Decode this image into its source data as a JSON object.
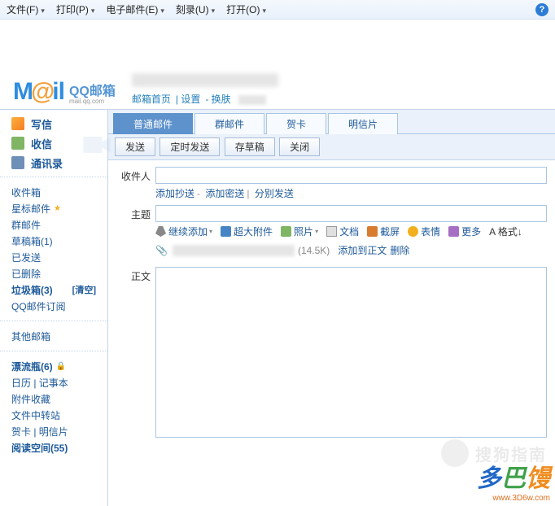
{
  "topbar": {
    "items": [
      "文件(F)",
      "打印(P)",
      "电子邮件(E)",
      "刻录(U)",
      "打开(O)"
    ],
    "help": "?"
  },
  "logo": {
    "brand_html": "M@il",
    "product": "QQ邮箱",
    "domain": "mail.qq.com"
  },
  "header_links": {
    "home": "邮箱首页",
    "settings": "设置",
    "switch": "换肤"
  },
  "sidebar": {
    "compose": "写信",
    "receive": "收信",
    "contacts": "通讯录",
    "folders": [
      {
        "label": "收件箱"
      },
      {
        "label": "星标邮件",
        "star": true
      },
      {
        "label": "群邮件"
      },
      {
        "label": "草稿箱(1)"
      },
      {
        "label": "已发送"
      },
      {
        "label": "已删除"
      },
      {
        "label": "垃圾箱(3)",
        "bold": true,
        "aux": "[清空]"
      },
      {
        "label": "QQ邮件订阅"
      }
    ],
    "other_header": "其他邮箱",
    "others": [
      {
        "label": "漂流瓶(6)",
        "bold": true,
        "lock": true
      },
      {
        "label": "日历 | 记事本"
      },
      {
        "label": "附件收藏"
      },
      {
        "label": "文件中转站"
      },
      {
        "label": "贺卡 | 明信片"
      },
      {
        "label": "阅读空间(55)",
        "bold": true
      }
    ]
  },
  "tabs": [
    "普通邮件",
    "群邮件",
    "贺卡",
    "明信片"
  ],
  "actions": [
    "发送",
    "定时发送",
    "存草稿",
    "关闭"
  ],
  "form": {
    "to_label": "收件人",
    "cc": {
      "add_cc": "添加抄送",
      "add_bcc": "添加密送",
      "separate": "分别发送"
    },
    "subject_label": "主题",
    "body_label": "正文"
  },
  "editor": {
    "attach": "继续添加",
    "big_attach": "超大附件",
    "photo": "照片",
    "doc": "文档",
    "screenshot": "截屏",
    "emoji": "表情",
    "more": "更多",
    "format": "A 格式↓"
  },
  "attachment": {
    "size": "(14.5K)",
    "add_body": "添加到正文",
    "delete": "删除"
  },
  "watermark": {
    "sogou": "搜狗指南",
    "brand": "多巴馒",
    "url": "www.3D6w.com"
  }
}
